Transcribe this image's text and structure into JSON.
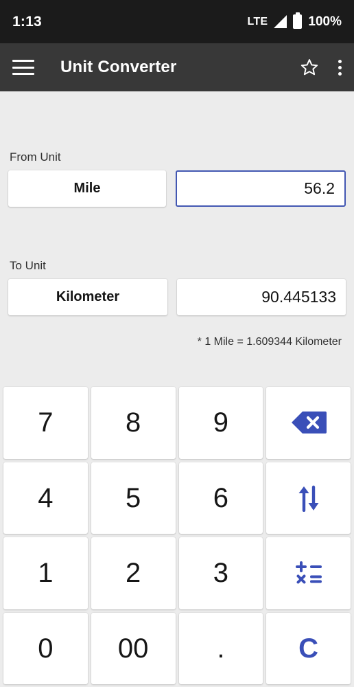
{
  "status_bar": {
    "clock": "1:13",
    "network_label": "LTE",
    "battery_percent": "100%",
    "signal_icon": "signal-triangle-icon",
    "battery_icon": "battery-full-icon"
  },
  "app_bar": {
    "menu_icon": "hamburger-menu-icon",
    "title": "Unit Converter",
    "favorite_icon": "star-outline-icon",
    "overflow_icon": "more-vertical-icon"
  },
  "converter": {
    "from": {
      "label": "From Unit",
      "unit": "Mile",
      "value": "56.2",
      "focused": true
    },
    "to": {
      "label": "To Unit",
      "unit": "Kilometer",
      "value": "90.445133",
      "focused": false
    },
    "note": "* 1 Mile = 1.609344 Kilometer"
  },
  "keypad": {
    "keys": [
      {
        "label": "7",
        "type": "digit",
        "name": "key-7"
      },
      {
        "label": "8",
        "type": "digit",
        "name": "key-8"
      },
      {
        "label": "9",
        "type": "digit",
        "name": "key-9"
      },
      {
        "label": "",
        "type": "icon",
        "icon": "backspace-icon",
        "name": "key-backspace"
      },
      {
        "label": "4",
        "type": "digit",
        "name": "key-4"
      },
      {
        "label": "5",
        "type": "digit",
        "name": "key-5"
      },
      {
        "label": "6",
        "type": "digit",
        "name": "key-6"
      },
      {
        "label": "",
        "type": "icon",
        "icon": "swap-vertical-icon",
        "name": "key-swap"
      },
      {
        "label": "1",
        "type": "digit",
        "name": "key-1"
      },
      {
        "label": "2",
        "type": "digit",
        "name": "key-2"
      },
      {
        "label": "3",
        "type": "digit",
        "name": "key-3"
      },
      {
        "label": "",
        "type": "icon",
        "icon": "calculator-icon",
        "name": "key-calculator"
      },
      {
        "label": "0",
        "type": "digit",
        "name": "key-0"
      },
      {
        "label": "00",
        "type": "digit",
        "name": "key-00"
      },
      {
        "label": ".",
        "type": "dot",
        "name": "key-decimal"
      },
      {
        "label": "C",
        "type": "clear",
        "name": "key-clear"
      }
    ]
  },
  "colors": {
    "accent": "#3a4fb8",
    "status_bar_bg": "#1b1b1b",
    "app_bar_bg": "#383838",
    "page_bg": "#ececec",
    "card_bg": "#ffffff",
    "focus_border": "#4257b2"
  }
}
